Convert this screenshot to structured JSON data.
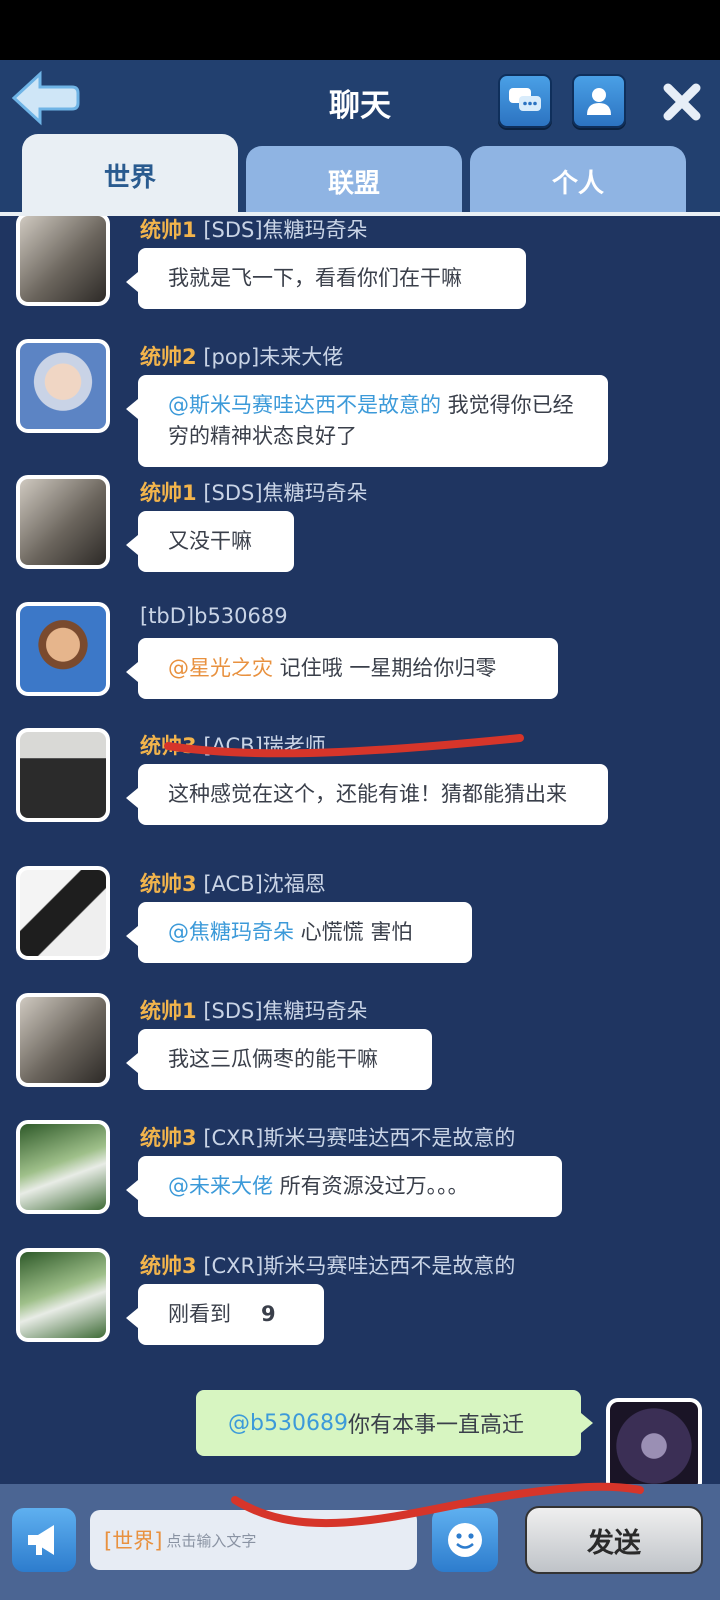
{
  "header": {
    "title": "聊天",
    "icons": [
      "back-arrow-icon",
      "chat-bubbles-icon",
      "profile-icon",
      "close-icon"
    ]
  },
  "tabs": [
    {
      "label": "世界",
      "active": true
    },
    {
      "label": "联盟",
      "active": false
    },
    {
      "label": "个人",
      "active": false
    }
  ],
  "messages": [
    {
      "rank": "统帅1",
      "name": "[SDS]焦糖玛奇朵",
      "mention": "",
      "text": "我就是飞一下，看看你们在干嘛"
    },
    {
      "rank": "统帅2",
      "name": "[pop]未来大佬",
      "mention": "@斯米马赛哇达西不是故意的",
      "text": " 我觉得你已经穷的精神状态良好了"
    },
    {
      "rank": "统帅1",
      "name": "[SDS]焦糖玛奇朵",
      "mention": "",
      "text": "又没干嘛"
    },
    {
      "rank": "",
      "name": "[tbD]b530689",
      "mention": "@星光之灾",
      "text": " 记住哦 一星期给你归零"
    },
    {
      "rank": "统帅3",
      "name": "[ACB]瑞老师",
      "mention": "",
      "text": "这种感觉在这个，还能有谁！猜都能猜出来"
    },
    {
      "rank": "统帅3",
      "name": "[ACB]沈福恩",
      "mention": "@焦糖玛奇朵",
      "text": " 心慌慌  害怕"
    },
    {
      "rank": "统帅1",
      "name": "[SDS]焦糖玛奇朵",
      "mention": "",
      "text": "我这三瓜俩枣的能干嘛"
    },
    {
      "rank": "统帅3",
      "name": "[CXR]斯米马赛哇达西不是故意的",
      "mention": "@未来大佬",
      "text": " 所有资源没过万。。。"
    },
    {
      "rank": "统帅3",
      "name": "[CXR]斯米马赛哇达西不是故意的",
      "mention": "",
      "text": "刚看到",
      "extra": "9"
    }
  ],
  "my_message": {
    "mention": "@b530689",
    "text": " 你有本事一直高迁"
  },
  "input": {
    "channel_tag": "[世界]",
    "placeholder": "点击输入文字"
  },
  "send_label": "发送",
  "colors": {
    "background": "#1f3561",
    "rank": "#f2b44c",
    "mention": "#3c9ad9",
    "mention_orange": "#e8913f",
    "my_bubble": "#d7f5c1",
    "scribble": "#d6352a"
  }
}
